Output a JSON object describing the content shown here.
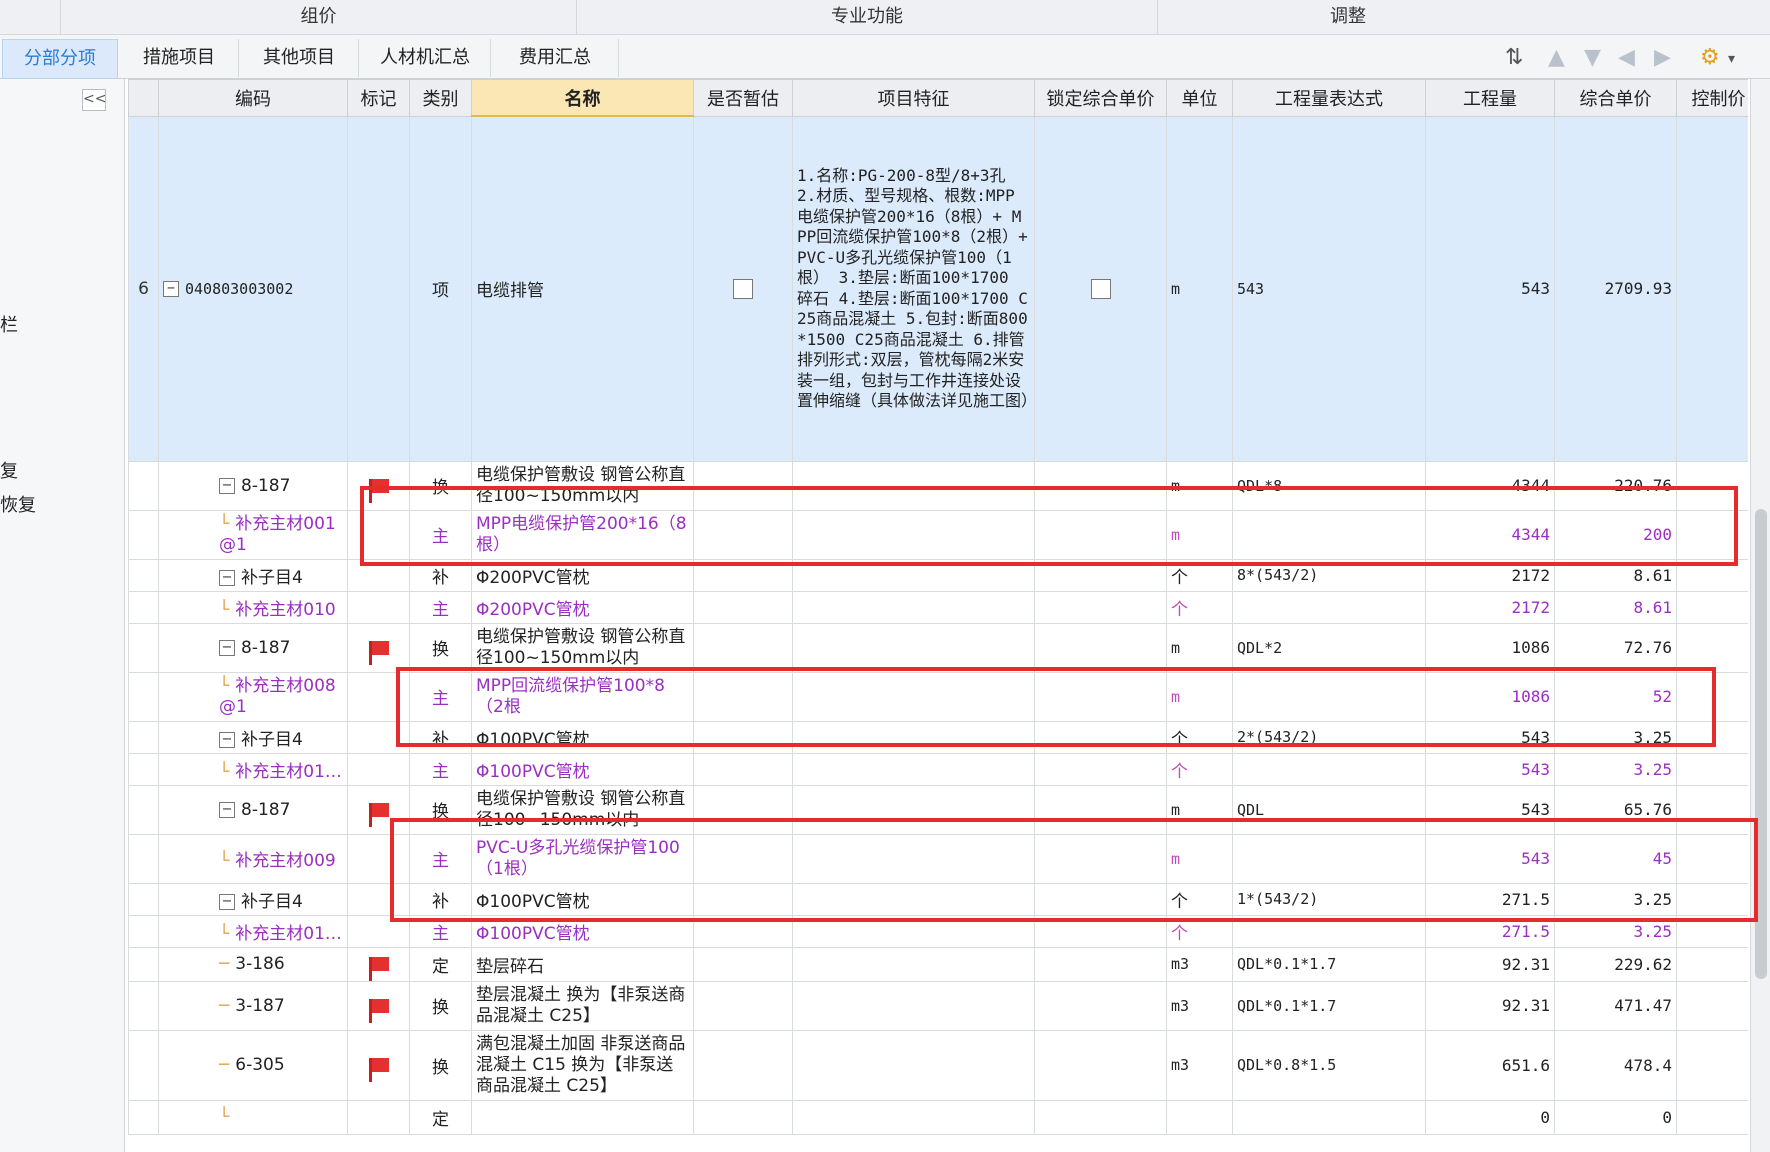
{
  "topbar": {
    "groups": [
      "组价",
      "专业功能",
      "调整"
    ]
  },
  "tabs": [
    "分部分项",
    "措施项目",
    "其他项目",
    "人材机汇总",
    "费用汇总"
  ],
  "left_panel": {
    "collapse": "<<",
    "items": [
      "栏",
      "复",
      "恢复"
    ]
  },
  "columns": [
    "编码",
    "标记",
    "类别",
    "名称",
    "是否暂估",
    "项目特征",
    "锁定综合单价",
    "单位",
    "工程量表达式",
    "工程量",
    "综合单价",
    "控制价"
  ],
  "rows": [
    {
      "idx": "6",
      "code": "040803003002",
      "category": "项",
      "name": "电缆排管",
      "feature": "1.名称:PG-200-8型/8+3孔 2.材质、型号规格、根数:MPP电缆保护管200*16（8根）+ MPP回流缆保护管100*8（2根）+ PVC-U多孔光缆保护管100（1根） 3.垫层:断面100*1700 碎石 4.垫层:断面100*1700 C25商品混凝土 5.包封:断面800*1500 C25商品混凝土 6.排管排列形式:双层，管枕每隔2米安装一组，包封与工作井连接处设置伸缩缝（具体做法详见施工图）",
      "unit": "m",
      "expr": "543",
      "qty": "543",
      "price": "2709.93"
    },
    {
      "code": "8-187",
      "category": "换",
      "name": "电缆保护管敷设 钢管公称直径100~150mm以内",
      "unit": "m",
      "expr": "QDL*8",
      "qty": "4344",
      "price": "220.76"
    },
    {
      "code": "补充主材001@1",
      "category": "主",
      "name": "MPP电缆保护管200*16（8根）",
      "unit": "m",
      "expr": "",
      "qty": "4344",
      "price": "200"
    },
    {
      "code": "补子目4",
      "category": "补",
      "name": "Φ200PVC管枕",
      "unit": "个",
      "expr": "8*(543/2)",
      "qty": "2172",
      "price": "8.61"
    },
    {
      "code": "补充主材010",
      "category": "主",
      "name": "Φ200PVC管枕",
      "unit": "个",
      "expr": "",
      "qty": "2172",
      "price": "8.61"
    },
    {
      "code": "8-187",
      "category": "换",
      "name": "电缆保护管敷设 钢管公称直径100~150mm以内",
      "unit": "m",
      "expr": "QDL*2",
      "qty": "1086",
      "price": "72.76"
    },
    {
      "code": "补充主材008@1",
      "category": "主",
      "name": "MPP回流缆保护管100*8（2根",
      "unit": "m",
      "expr": "",
      "qty": "1086",
      "price": "52"
    },
    {
      "code": "补子目4",
      "category": "补",
      "name": "Φ100PVC管枕",
      "unit": "个",
      "expr": "2*(543/2)",
      "qty": "543",
      "price": "3.25"
    },
    {
      "code": "补充主材01…",
      "category": "主",
      "name": "Φ100PVC管枕",
      "unit": "个",
      "expr": "",
      "qty": "543",
      "price": "3.25"
    },
    {
      "code": "8-187",
      "category": "换",
      "name": "电缆保护管敷设 钢管公称直径100~150mm以内",
      "unit": "m",
      "expr": "QDL",
      "qty": "543",
      "price": "65.76"
    },
    {
      "code": "补充主材009",
      "category": "主",
      "name": "PVC-U多孔光缆保护管100（1根）",
      "unit": "m",
      "expr": "",
      "qty": "543",
      "price": "45"
    },
    {
      "code": "补子目4",
      "category": "补",
      "name": "Φ100PVC管枕",
      "unit": "个",
      "expr": "1*(543/2)",
      "qty": "271.5",
      "price": "3.25"
    },
    {
      "code": "补充主材01…",
      "category": "主",
      "name": "Φ100PVC管枕",
      "unit": "个",
      "expr": "",
      "qty": "271.5",
      "price": "3.25"
    },
    {
      "code": "3-186",
      "category": "定",
      "name": "垫层碎石",
      "unit": "m3",
      "expr": "QDL*0.1*1.7",
      "qty": "92.31",
      "price": "229.62"
    },
    {
      "code": "3-187",
      "category": "换",
      "name": "垫层混凝土 换为【非泵送商品混凝土 C25】",
      "unit": "m3",
      "expr": "QDL*0.1*1.7",
      "qty": "92.31",
      "price": "471.47"
    },
    {
      "code": "6-305",
      "category": "换",
      "name": "满包混凝土加固 非泵送商品混凝土 C15 换为【非泵送商品混凝土 C25】",
      "unit": "m3",
      "expr": "QDL*0.8*1.5",
      "qty": "651.6",
      "price": "478.4"
    },
    {
      "code": "",
      "category": "定",
      "name": "",
      "unit": "",
      "expr": "",
      "qty": "0",
      "price": "0"
    }
  ]
}
